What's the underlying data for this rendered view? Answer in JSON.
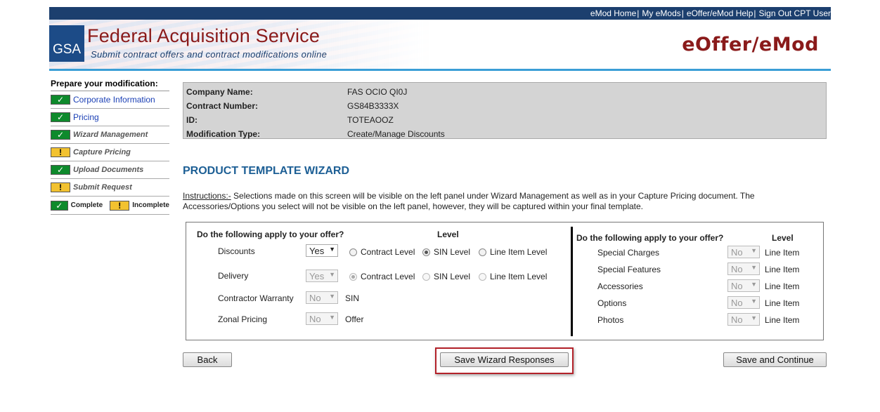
{
  "topnav": {
    "links": [
      "eMod Home",
      "My eMods",
      "eOffer/eMod Help",
      "Sign Out CPT User"
    ],
    "separator": "|"
  },
  "header": {
    "logo_text": "GSA",
    "org_title": "Federal Acquisition Service",
    "org_subtitle": "Submit contract offers and contract modifications online",
    "app_title": "eOffer/eMod"
  },
  "sidebar": {
    "title": "Prepare your modification:",
    "steps": [
      {
        "label": "Corporate Information",
        "status": "complete",
        "link": true
      },
      {
        "label": "Pricing",
        "status": "complete",
        "link": true
      },
      {
        "label": "Wizard Management",
        "status": "complete",
        "link": false
      },
      {
        "label": "Capture Pricing",
        "status": "incomplete",
        "link": false
      },
      {
        "label": "Upload Documents",
        "status": "complete",
        "link": false
      },
      {
        "label": "Submit Request",
        "status": "incomplete",
        "link": false
      }
    ],
    "legend": {
      "complete": "Complete",
      "incomplete": "Incomplete",
      "check_glyph": "✓",
      "warn_glyph": "!"
    }
  },
  "info": {
    "rows": [
      {
        "label": "Company Name:",
        "value": "FAS OCIO QI0J"
      },
      {
        "label": "Contract Number:",
        "value": "GS84B3333X"
      },
      {
        "label": "ID:",
        "value": "TOTEAOOZ"
      },
      {
        "label": "Modification Type:",
        "value": "Create/Manage Discounts"
      }
    ]
  },
  "wizard": {
    "title": "PRODUCT TEMPLATE WIZARD",
    "instructions_lead": "Instructions:-",
    "instructions_text": " Selections made on this screen will be visible on the left panel under Wizard Management as well as in your Capture Pricing document. The Accessories/Options you select will not be visible on the left panel, however, they will be captured within your final template.",
    "left": {
      "question": "Do the following apply to your offer?",
      "level_header": "Level",
      "rows": {
        "discounts": {
          "label": "Discounts",
          "value": "Yes",
          "options": [
            "Contract Level",
            "SIN Level",
            "Line Item Level"
          ],
          "selected": "SIN Level"
        },
        "delivery": {
          "label": "Delivery",
          "value": "Yes",
          "options": [
            "Contract Level",
            "SIN Level",
            "Line Item Level"
          ],
          "selected": "Contract Level"
        },
        "warranty": {
          "label": "Contractor Warranty",
          "value": "No",
          "level": "SIN"
        },
        "zonal": {
          "label": "Zonal Pricing",
          "value": "No",
          "level": "Offer"
        }
      }
    },
    "right": {
      "question": "Do the following apply to your offer?",
      "level_header": "Level",
      "rows": [
        {
          "label": "Special Charges",
          "value": "No",
          "level": "Line Item"
        },
        {
          "label": "Special Features",
          "value": "No",
          "level": "Line Item"
        },
        {
          "label": "Accessories",
          "value": "No",
          "level": "Line Item"
        },
        {
          "label": "Options",
          "value": "No",
          "level": "Line Item"
        },
        {
          "label": "Photos",
          "value": "No",
          "level": "Line Item"
        }
      ]
    }
  },
  "buttons": {
    "back": "Back",
    "save_wizard": "Save Wizard Responses",
    "save_continue": "Save and Continue"
  },
  "colors": {
    "nav_bg": "#1c3f6e",
    "brand_red": "#8a1a1a",
    "rule_blue": "#3a9ed6",
    "title_blue": "#1d5f95",
    "complete_green": "#0e8a2c",
    "incomplete_yellow": "#f2c230",
    "highlight_red": "#b3222a"
  }
}
